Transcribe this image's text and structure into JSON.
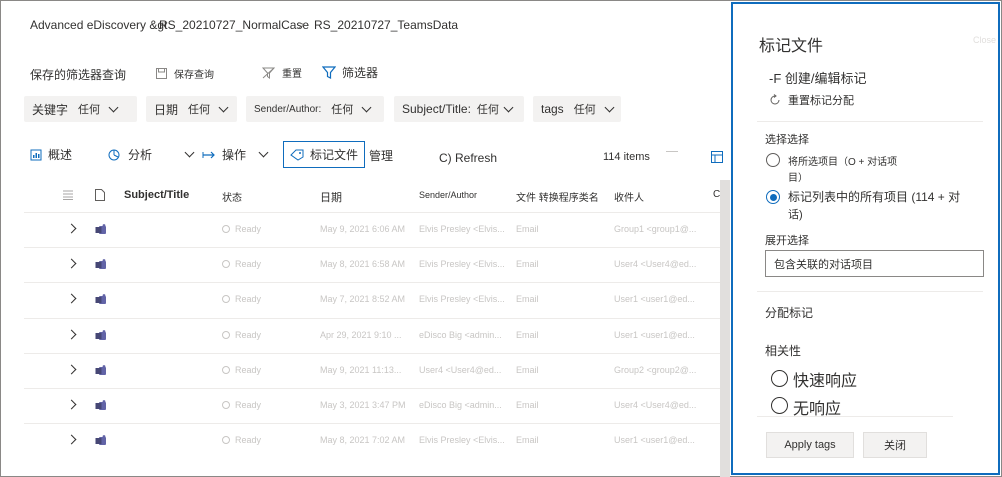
{
  "breadcrumb": {
    "items": [
      "Advanced eDiscovery &gt",
      "RS_20210727_NormalCase",
      "RS_20210727_TeamsData"
    ],
    "separator": ">"
  },
  "command_bar": {
    "saved_queries": "保存的筛选器查询",
    "save_query": "保存查询",
    "reset": "重置",
    "filters": "筛选器"
  },
  "filters": [
    {
      "label": "关键字",
      "value": "任何"
    },
    {
      "label": "日期",
      "value": "任何"
    },
    {
      "label": "Sender/Author:",
      "value": "任何"
    },
    {
      "label": "Subject/Title:",
      "value": "任何"
    },
    {
      "label": "tags",
      "value": "任何"
    }
  ],
  "toolbar": {
    "overview": "概述",
    "analyze": "分析",
    "actions": "操作",
    "tag_files": "标记文件",
    "manage": "管理",
    "refresh": "C) Refresh",
    "item_count": "114 items"
  },
  "table": {
    "columns": [
      "Subject/Title",
      "状态",
      "日期",
      "Sender/Author",
      "文件 转换程序类名",
      "收件人",
      "C"
    ],
    "rows": [
      {
        "status": "Ready",
        "date": "May 9, 2021 6:06 AM",
        "sender": "Elvis Presley <Elvis...",
        "type": "Email",
        "recipient": "Group1 <group1@..."
      },
      {
        "status": "Ready",
        "date": "May 8, 2021 6:58 AM",
        "sender": "Elvis Presley <Elvis...",
        "type": "Email",
        "recipient": "User4 <User4@ed..."
      },
      {
        "status": "Ready",
        "date": "May 7, 2021 8:52 AM",
        "sender": "Elvis Presley <Elvis...",
        "type": "Email",
        "recipient": "User1 <user1@ed..."
      },
      {
        "status": "Ready",
        "date": "Apr 29, 2021 9:10 ...",
        "sender": "eDisco Big <admin...",
        "type": "Email",
        "recipient": "User1 <user1@ed..."
      },
      {
        "status": "Ready",
        "date": "May 9, 2021 11:13...",
        "sender": "User4 <User4@ed...",
        "type": "Email",
        "recipient": "Group2 <group2@..."
      },
      {
        "status": "Ready",
        "date": "May 3, 2021 3:47 PM",
        "sender": "eDisco Big <admin...",
        "type": "Email",
        "recipient": "User4 <User4@ed..."
      },
      {
        "status": "Ready",
        "date": "May 8, 2021 7:02 AM",
        "sender": "Elvis Presley <Elvis...",
        "type": "Email",
        "recipient": "User1 <user1@ed..."
      }
    ]
  },
  "panel": {
    "title": "标记文件",
    "close_hint": "Close",
    "create_edit": "-F 创建/编辑标记",
    "reset_tags": "重置标记分配",
    "selection_heading": "选择选择",
    "option_selected_items": "将所选项目（O + 对话项",
    "option_selected_items_wrap": "目）",
    "option_all_items": "标记列表中的所有项目 (114 + 对",
    "option_all_items_wrap": "话)",
    "expand_heading": "展开选择",
    "expand_value": "包含关联的对话项目",
    "assign_tags": "分配标记",
    "relevance": "相关性",
    "responsive": "快速响应",
    "non_responsive": "无响应",
    "apply_button": "Apply tags",
    "close_button": "关闭"
  },
  "colors": {
    "accent": "#0f6cbd",
    "panel_border": "#0f6cbd"
  }
}
